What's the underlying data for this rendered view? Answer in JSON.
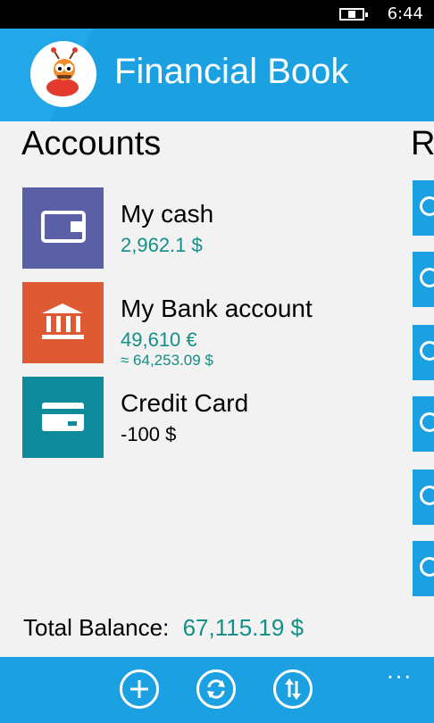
{
  "status_bar": {
    "time": "6:44"
  },
  "header": {
    "title": "Financial Book"
  },
  "accounts": {
    "heading": "Accounts",
    "items": [
      {
        "name": "My cash",
        "amount": "2,962.1 $",
        "approx": "",
        "color": "#5b5fa5",
        "icon": "wallet-icon"
      },
      {
        "name": "My Bank account",
        "amount": "49,610 €",
        "approx": "≈ 64,253.09 $",
        "color": "#de5a32",
        "icon": "bank-icon"
      },
      {
        "name": "Credit Card",
        "amount": "-100 $",
        "approx": "",
        "color": "#0f8a9b",
        "icon": "credit-card-icon"
      }
    ]
  },
  "right_panel": {
    "heading": "R"
  },
  "total": {
    "label": "Total Balance:",
    "value": "67,115.19 $"
  },
  "appbar": {
    "buttons": [
      "add-icon",
      "sync-icon",
      "transfer-icon"
    ],
    "more": "..."
  },
  "colors": {
    "accent": "#1ba0e1",
    "money_green": "#138f86"
  }
}
